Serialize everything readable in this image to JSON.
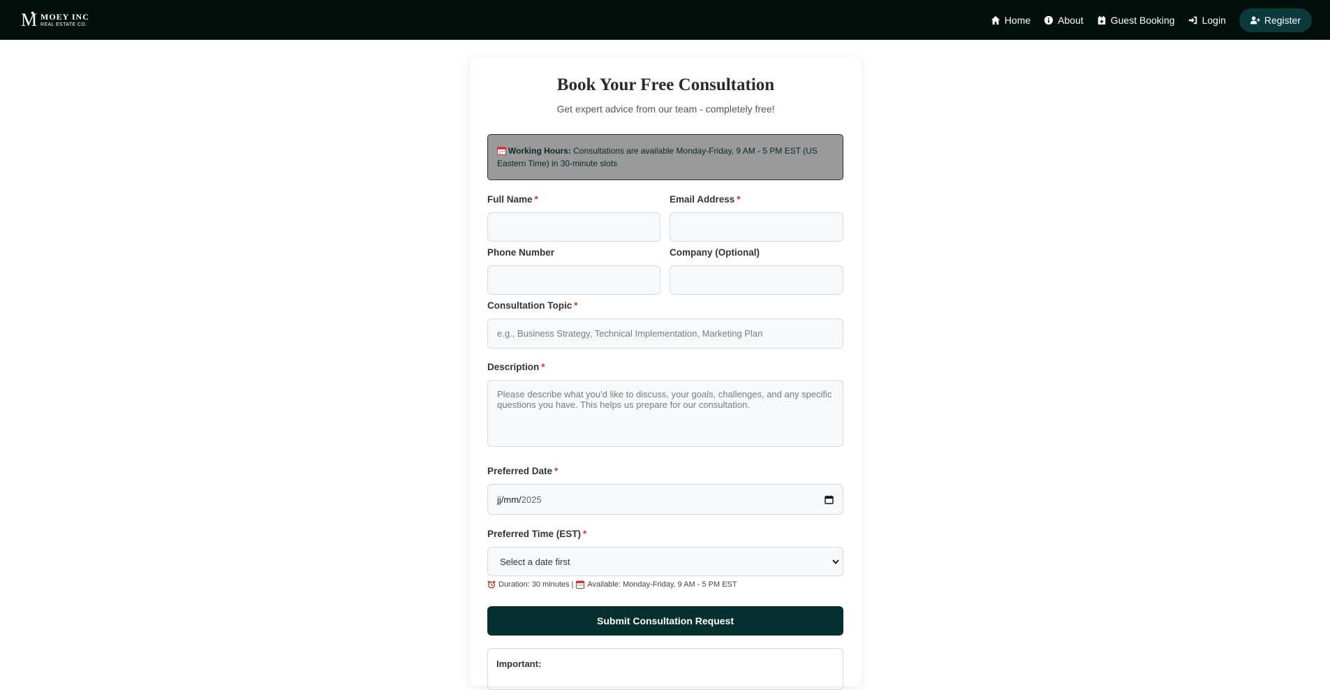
{
  "brand": {
    "name": "MOEY INC",
    "tagline": "REAL ESTATE CO.",
    "mark": "M"
  },
  "nav": {
    "home": "Home",
    "about": "About",
    "guest_booking": "Guest Booking",
    "login": "Login",
    "register": "Register"
  },
  "page": {
    "title": "Book Your Free Consultation",
    "subtitle": "Get expert advice from our team - completely free!"
  },
  "notice": {
    "heading": "Working Hours:",
    "text": " Consultations are available Monday-Friday, 9 AM - 5 PM EST (US Eastern Time) in 30-minute slots"
  },
  "form": {
    "full_name": {
      "label": "Full Name",
      "required": "*",
      "value": ""
    },
    "email": {
      "label": "Email Address",
      "required": "*",
      "value": ""
    },
    "phone": {
      "label": "Phone Number",
      "value": ""
    },
    "company": {
      "label": "Company (Optional)",
      "value": ""
    },
    "topic": {
      "label": "Consultation Topic",
      "required": "*",
      "placeholder": "e.g., Business Strategy, Technical Implementation, Marketing Plan"
    },
    "description": {
      "label": "Description",
      "required": "*",
      "placeholder": "Please describe what you'd like to discuss, your goals, challenges, and any specific questions you have. This helps us prepare for our consultation."
    },
    "date": {
      "label": "Preferred Date",
      "required": "*",
      "mask": "jj/mm/",
      "year": "2025"
    },
    "time": {
      "label": "Preferred Time (EST)",
      "required": "*",
      "selected": "Select a date first"
    },
    "hint": {
      "duration": "Duration: 30 minutes |",
      "available": "Available: Monday-Friday, 9 AM - 5 PM EST"
    },
    "submit": "Submit Consultation Request"
  },
  "info_box": {
    "heading": "Important:"
  },
  "colors": {
    "navbar": "#020f0b",
    "accent": "#05302f",
    "notice_bg": "#9a9a9a",
    "required": "#d9342b"
  }
}
